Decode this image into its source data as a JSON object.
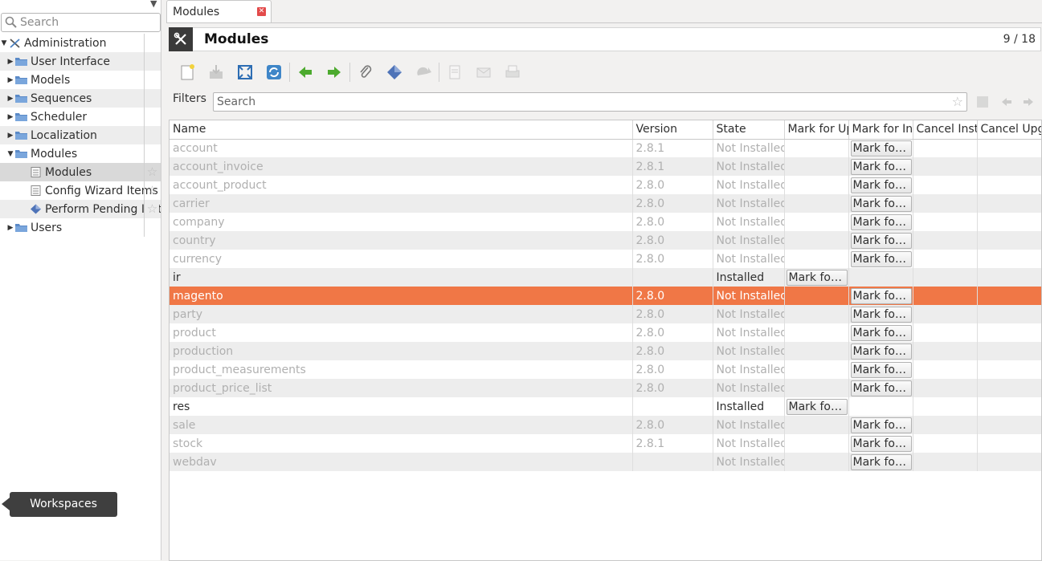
{
  "sidebar": {
    "search_placeholder": "Search",
    "tree": [
      {
        "label": "Administration",
        "expanded": true,
        "icon": "tools-icon",
        "level": 0
      },
      {
        "label": "User Interface",
        "expanded": false,
        "icon": "folder-icon",
        "level": 1
      },
      {
        "label": "Models",
        "expanded": false,
        "icon": "folder-icon",
        "level": 1
      },
      {
        "label": "Sequences",
        "expanded": false,
        "icon": "folder-icon",
        "level": 1
      },
      {
        "label": "Scheduler",
        "expanded": false,
        "icon": "folder-icon",
        "level": 1
      },
      {
        "label": "Localization",
        "expanded": false,
        "icon": "folder-icon",
        "level": 1
      },
      {
        "label": "Modules",
        "expanded": true,
        "icon": "folder-icon",
        "level": 1
      },
      {
        "label": "Modules",
        "icon": "list-icon",
        "level": 2,
        "selected": true
      },
      {
        "label": "Config Wizard Items",
        "icon": "list-icon",
        "level": 2
      },
      {
        "label": "Perform Pending Installation/Upgrade",
        "icon": "wizard-icon",
        "level": 2
      },
      {
        "label": "Users",
        "expanded": false,
        "icon": "folder-icon",
        "level": 1
      }
    ],
    "workspaces_label": "Workspaces"
  },
  "tab": {
    "label": "Modules"
  },
  "header": {
    "title": "Modules",
    "record_count": "9 / 18"
  },
  "filters": {
    "label": "Filters",
    "placeholder": "Search"
  },
  "table": {
    "columns": [
      "Name",
      "Version",
      "State",
      "Mark for Upgrade",
      "Mark for Installation",
      "Cancel Installation",
      "Cancel Upgrade"
    ],
    "button_label": "Mark fo…",
    "rows": [
      {
        "name": "account",
        "version": "2.8.1",
        "state": "Not Installed",
        "upgrade_btn": false,
        "install_btn": true
      },
      {
        "name": "account_invoice",
        "version": "2.8.1",
        "state": "Not Installed",
        "upgrade_btn": false,
        "install_btn": true
      },
      {
        "name": "account_product",
        "version": "2.8.0",
        "state": "Not Installed",
        "upgrade_btn": false,
        "install_btn": true
      },
      {
        "name": "carrier",
        "version": "2.8.0",
        "state": "Not Installed",
        "upgrade_btn": false,
        "install_btn": true
      },
      {
        "name": "company",
        "version": "2.8.0",
        "state": "Not Installed",
        "upgrade_btn": false,
        "install_btn": true
      },
      {
        "name": "country",
        "version": "2.8.0",
        "state": "Not Installed",
        "upgrade_btn": false,
        "install_btn": true
      },
      {
        "name": "currency",
        "version": "2.8.0",
        "state": "Not Installed",
        "upgrade_btn": false,
        "install_btn": true
      },
      {
        "name": "ir",
        "version": "",
        "state": "Installed",
        "upgrade_btn": true,
        "install_btn": false
      },
      {
        "name": "magento",
        "version": "2.8.0",
        "state": "Not Installed",
        "upgrade_btn": false,
        "install_btn": true,
        "selected": true
      },
      {
        "name": "party",
        "version": "2.8.0",
        "state": "Not Installed",
        "upgrade_btn": false,
        "install_btn": true
      },
      {
        "name": "product",
        "version": "2.8.0",
        "state": "Not Installed",
        "upgrade_btn": false,
        "install_btn": true
      },
      {
        "name": "production",
        "version": "2.8.0",
        "state": "Not Installed",
        "upgrade_btn": false,
        "install_btn": true
      },
      {
        "name": "product_measurements",
        "version": "2.8.0",
        "state": "Not Installed",
        "upgrade_btn": false,
        "install_btn": true
      },
      {
        "name": "product_price_list",
        "version": "2.8.0",
        "state": "Not Installed",
        "upgrade_btn": false,
        "install_btn": true
      },
      {
        "name": "res",
        "version": "",
        "state": "Installed",
        "upgrade_btn": true,
        "install_btn": false
      },
      {
        "name": "sale",
        "version": "2.8.0",
        "state": "Not Installed",
        "upgrade_btn": false,
        "install_btn": true
      },
      {
        "name": "stock",
        "version": "2.8.1",
        "state": "Not Installed",
        "upgrade_btn": false,
        "install_btn": true
      },
      {
        "name": "webdav",
        "version": "",
        "state": "Not Installed",
        "upgrade_btn": false,
        "install_btn": true
      }
    ]
  },
  "colors": {
    "selection": "#f07746",
    "dim_text": "#b0b0b0",
    "header_icon_bg": "#3a3a3a",
    "tooltip_bg": "#3f3f3f"
  }
}
